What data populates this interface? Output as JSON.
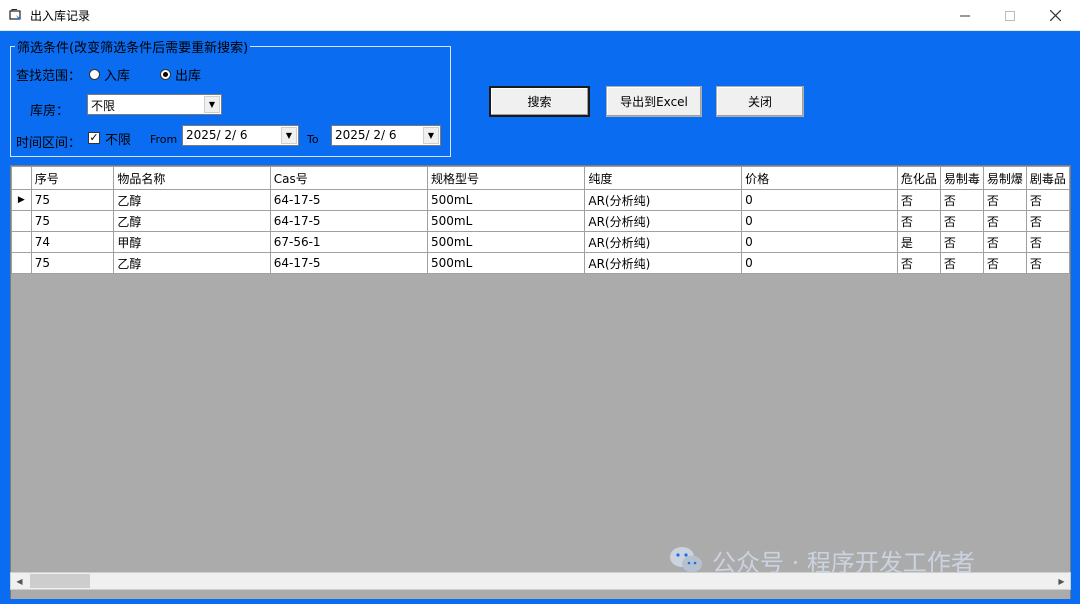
{
  "window": {
    "title": "出入库记录"
  },
  "filter": {
    "caption": "筛选条件(改变筛选条件后需要重新搜索)",
    "scope_label": "查找范围：",
    "scope_options": [
      {
        "label": "入库",
        "checked": false
      },
      {
        "label": "出库",
        "checked": true
      }
    ],
    "warehouse_label": "库房：",
    "warehouse_value": "不限",
    "time_label": "时间区间：",
    "unlimited_label": "不限",
    "unlimited_checked": true,
    "from_label": "From",
    "from_value": "2025/ 2/ 6",
    "to_label": "To",
    "to_value": "2025/ 2/ 6"
  },
  "buttons": {
    "search": "搜索",
    "export": "导出到Excel",
    "close": "关闭"
  },
  "grid": {
    "columns": [
      "序号",
      "物品名称",
      "Cas号",
      "规格型号",
      "纯度",
      "价格",
      "危化品",
      "易制毒",
      "易制爆",
      "剧毒品"
    ],
    "rows": [
      [
        "75",
        "乙醇",
        "64-17-5",
        "500mL",
        "AR(分析纯)",
        "0",
        "否",
        "否",
        "否",
        "否"
      ],
      [
        "75",
        "乙醇",
        "64-17-5",
        "500mL",
        "AR(分析纯)",
        "0",
        "否",
        "否",
        "否",
        "否"
      ],
      [
        "74",
        "甲醇",
        "67-56-1",
        "500mL",
        "AR(分析纯)",
        "0",
        "是",
        "否",
        "否",
        "否"
      ],
      [
        "75",
        "乙醇",
        "64-17-5",
        "500mL",
        "AR(分析纯)",
        "0",
        "否",
        "否",
        "否",
        "否"
      ]
    ],
    "current_row_indicator": "▶"
  },
  "watermark": {
    "text": "公众号 · 程序开发工作者"
  },
  "colors": {
    "client_background": "#0a6cf0"
  }
}
